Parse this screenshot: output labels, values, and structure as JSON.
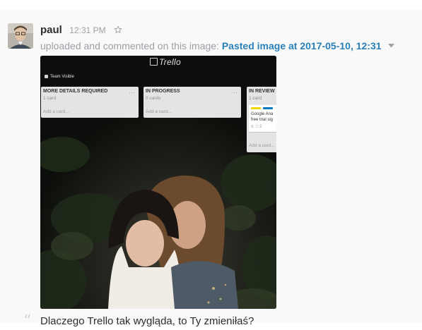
{
  "message": {
    "author": "paul",
    "time": "12:31 PM",
    "action_text": "uploaded and commented on this image:",
    "file_title": "Pasted image at 2017-05-10, 12:31",
    "comment": "Dlaczego Trello tak wygląda, to Ty zmieniłaś?",
    "quote_glyph": "“"
  },
  "trello_board": {
    "logo_text": "Trello",
    "team_label": "Team Visible",
    "lists": [
      {
        "title": "MORE DETAILS REQUIRED",
        "count": "1 card",
        "add_text": "Add a card..."
      },
      {
        "title": "IN PROGRESS",
        "count": "0 cards",
        "add_text": "Add a card..."
      },
      {
        "title": "IN REVIEW",
        "count": "1 card",
        "add_text": "Add a card...",
        "card": {
          "title_line1": "Google Ana",
          "title_line2": "free trial sig",
          "comments_count": "2",
          "label_colors": [
            "#f2d600",
            "#0079bf"
          ]
        }
      }
    ],
    "menu_glyph": "…"
  },
  "colors": {
    "link": "#2a80b9",
    "muted": "#9e9ea6",
    "text": "#2c2d30",
    "message_background": "#f9f9f9"
  },
  "icons": [
    "avatar",
    "star-icon",
    "chevron-down-icon",
    "quote-icon"
  ]
}
